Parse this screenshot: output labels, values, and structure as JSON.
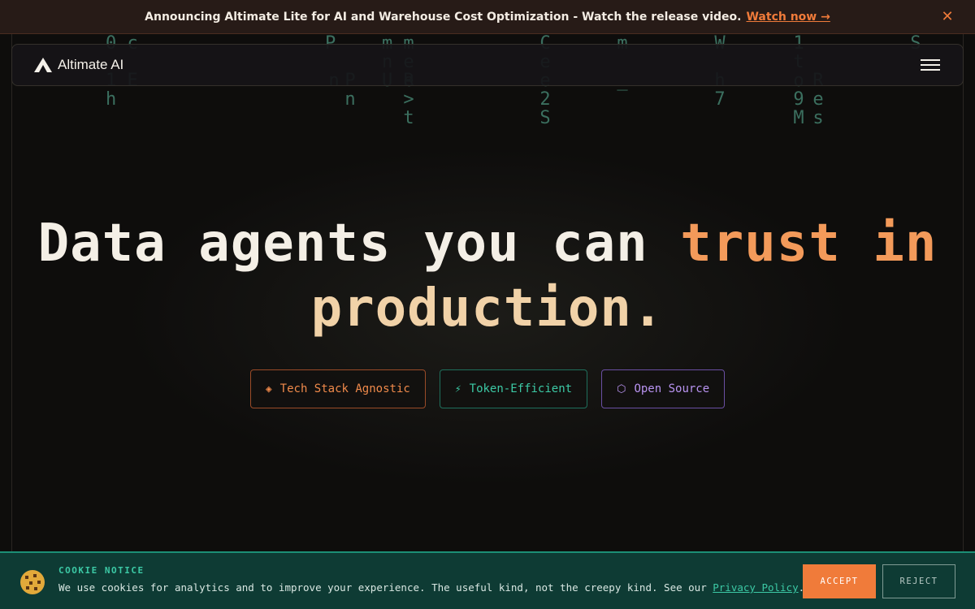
{
  "announcement": {
    "message": "Announcing Altimate Lite for AI and Warehouse Cost Optimization - Watch the release video.",
    "link_label": "Watch now →",
    "close_icon": "close-icon"
  },
  "navbar": {
    "brand": "Altimate AI",
    "logo_icon": "altimate-logo-icon",
    "menu_icon": "hamburger-menu-icon"
  },
  "background_glyphs": [
    {
      "chars": "0 c\n \n1 E\nh"
    },
    {
      "chars": " \n \n \n"
    },
    {
      "chars": "P \n \nn"
    },
    {
      "chars": "m\nn\nU R"
    },
    {
      "chars": "m\ne\ne\n>\nt"
    },
    {
      "chars": "C\ne\ne\n2\nS"
    },
    {
      "chars": "m\n \n_"
    },
    {
      "chars": "W\n \nh\n7"
    },
    {
      "chars": "1\nt\no\n9\nM"
    },
    {
      "chars": " \n \nR\ne\ns"
    },
    {
      "chars": "S"
    }
  ],
  "hero": {
    "title_part1": "Data agents you can ",
    "title_accent": "trust in",
    "title_part2": "production."
  },
  "badges": [
    {
      "label": "Tech Stack Agnostic",
      "icon": "◈",
      "icon_name": "diamond-icon"
    },
    {
      "label": "Token-Efficient",
      "icon": "⚡",
      "icon_name": "lightning-icon"
    },
    {
      "label": "Open Source",
      "icon": "⬡",
      "icon_name": "hexagon-icon"
    }
  ],
  "cookie": {
    "title": "COOKIE NOTICE",
    "text": "We use cookies for analytics and to improve your experience. The useful kind, not the creepy kind. See our ",
    "policy_link": "Privacy Policy",
    "period": ".",
    "accept": "ACCEPT",
    "reject": "REJECT",
    "icon": "cookie-icon"
  },
  "colors": {
    "accent_orange": "#f07b3a",
    "accent_teal": "#3cc9a5",
    "accent_purple": "#b893f0",
    "background": "#0e0d0c"
  }
}
